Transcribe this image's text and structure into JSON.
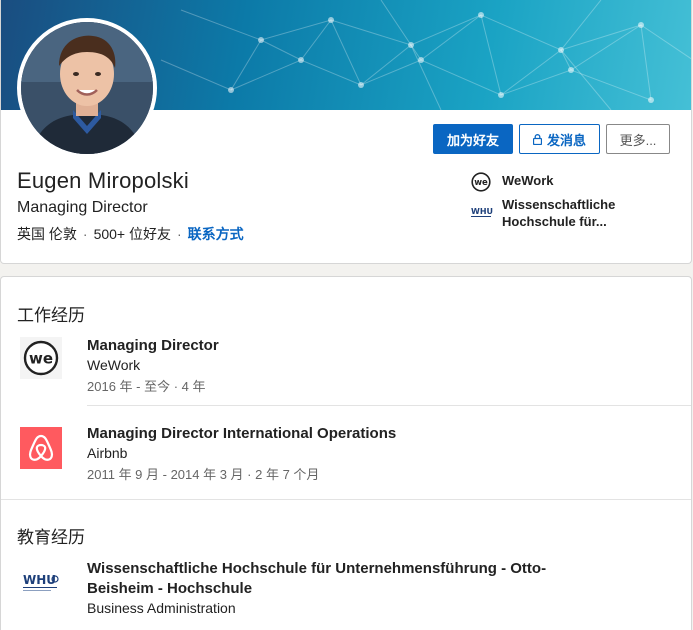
{
  "profile": {
    "name": "Eugen Miropolski",
    "headline": "Managing Director",
    "location": "英国 伦敦",
    "connections": "500+ 位好友",
    "contact_label": "联系方式",
    "meta_separator": "·"
  },
  "actions": {
    "add_friend": "加为好友",
    "message": "发消息",
    "more": "更多..."
  },
  "organizations": [
    {
      "name": "WeWork",
      "icon": "wework-logo"
    },
    {
      "name": "Wissenschaftliche Hochschule für...",
      "icon": "whu-logo"
    }
  ],
  "experience": {
    "title": "工作经历",
    "items": [
      {
        "title": "Managing Director",
        "company": "WeWork",
        "dates": "2016 年 - 至今 · 4 年",
        "icon": "wework-logo"
      },
      {
        "title": "Managing Director International Operations",
        "company": "Airbnb",
        "dates": "2011 年 9 月 - 2014 年 3 月 · 2 年 7 个月",
        "icon": "airbnb-logo"
      }
    ]
  },
  "education": {
    "title": "教育经历",
    "items": [
      {
        "school": "Wissenschaftliche Hochschule für Unternehmensführung - Otto-Beisheim - Hochschule",
        "field": "Business Administration",
        "icon": "whu-logo"
      }
    ]
  },
  "logo_text": {
    "wework": "we",
    "whu": "WHU"
  },
  "colors": {
    "brand_blue": "#0a66c2",
    "airbnb": "#ff5a5f",
    "banner_start": "#1a4d80",
    "banner_end": "#45c0d6"
  }
}
